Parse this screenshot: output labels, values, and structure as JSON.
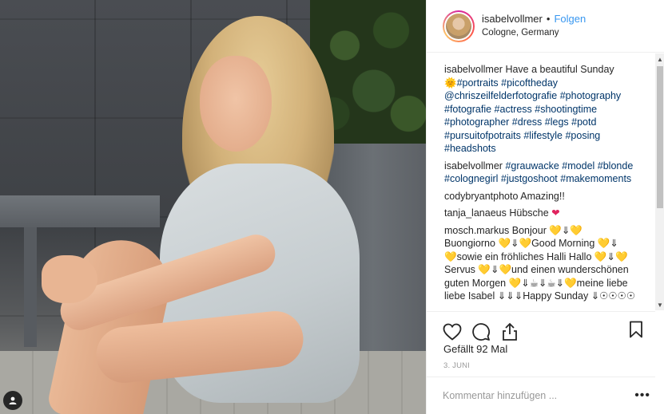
{
  "post": {
    "username": "isabelvollmer",
    "separator": "•",
    "follow_label": "Folgen",
    "location": "Cologne, Germany"
  },
  "caption": {
    "username": "isabelvollmer",
    "text": "Have a beautiful Sunday",
    "emoji": "🌞",
    "hashtags_1": "#portraits #picoftheday",
    "mention": "@chriszeilfelderfotografie",
    "hashtags_2": "#photography #fotografie #actress #shootingtime #photographer #dress #legs #potd #pursuitofpotraits #lifestyle #posing #headshots"
  },
  "comments": [
    {
      "username": "isabelvollmer",
      "text": "#grauwacke #model #blonde #colognegirl #justgoshoot #makemoments"
    },
    {
      "username": "codybryantphoto",
      "text": "Amazing!!"
    },
    {
      "username": "tanja_lanaeus",
      "text": "Hübsche",
      "emoji": "❤"
    },
    {
      "username": "mosch.markus",
      "line1": "Bonjour",
      "line2a": "Buongiorno",
      "line2b": "Good Morning",
      "line3": "sowie ein fröhliches Halli Hallo",
      "line4a": "Servus",
      "line4b": "und einen wunderschönen",
      "line5a": "guten Morgen",
      "line5b": "meine liebe",
      "line6a": "liebe Isabel",
      "line6b": "Happy Sunday",
      "heart": "💛",
      "arrow": "⇓",
      "cup": "☕",
      "sun": "☉"
    }
  ],
  "likes_label": "Gefällt 92 Mal",
  "date": "3. JUNI",
  "comment_placeholder": "Kommentar hinzufügen ...",
  "more_label": "•••",
  "icons": {
    "like": "heart-outline-icon",
    "comment": "comment-bubble-icon",
    "share": "share-icon",
    "save": "bookmark-icon",
    "user_tag": "user-tag-icon"
  }
}
